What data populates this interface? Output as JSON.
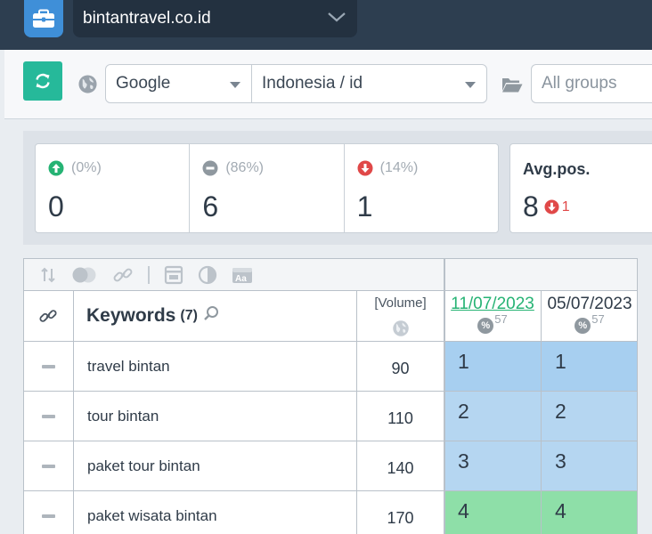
{
  "header": {
    "site_name": "bintantravel.co.id"
  },
  "toolbar": {
    "engine": "Google",
    "region": "Indonesia / id",
    "groups_placeholder": "All groups"
  },
  "stats": [
    {
      "name": "up",
      "percent": "(0%)",
      "value": "0",
      "color": "#26b374"
    },
    {
      "name": "unchanged",
      "percent": "(86%)",
      "value": "6",
      "color": "#8f989f"
    },
    {
      "name": "down",
      "percent": "(14%)",
      "value": "1",
      "color": "#e04848"
    }
  ],
  "avg": {
    "label": "Avg.pos.",
    "value": "8",
    "change": "1"
  },
  "table": {
    "keywords_label": "Keywords",
    "keywords_count": "(7)",
    "volume_label": "[Volume]",
    "dates": [
      {
        "date": "11/07/2023",
        "percent": "57",
        "active": true
      },
      {
        "date": "05/07/2023",
        "percent": "57",
        "active": false
      }
    ],
    "rows": [
      {
        "keyword": "travel bintan",
        "volume": "90",
        "positions": [
          "1",
          "1"
        ],
        "colors": [
          "#a7cff0",
          "#a7cff0"
        ]
      },
      {
        "keyword": "tour bintan",
        "volume": "110",
        "positions": [
          "2",
          "2"
        ],
        "colors": [
          "#b5d6f1",
          "#b5d6f1"
        ]
      },
      {
        "keyword": "paket tour bintan",
        "volume": "140",
        "positions": [
          "3",
          "3"
        ],
        "colors": [
          "#b5d6f1",
          "#b5d6f1"
        ]
      },
      {
        "keyword": "paket wisata bintan",
        "volume": "170",
        "positions": [
          "4",
          "4"
        ],
        "colors": [
          "#8edfa8",
          "#8edfa8"
        ]
      }
    ]
  }
}
